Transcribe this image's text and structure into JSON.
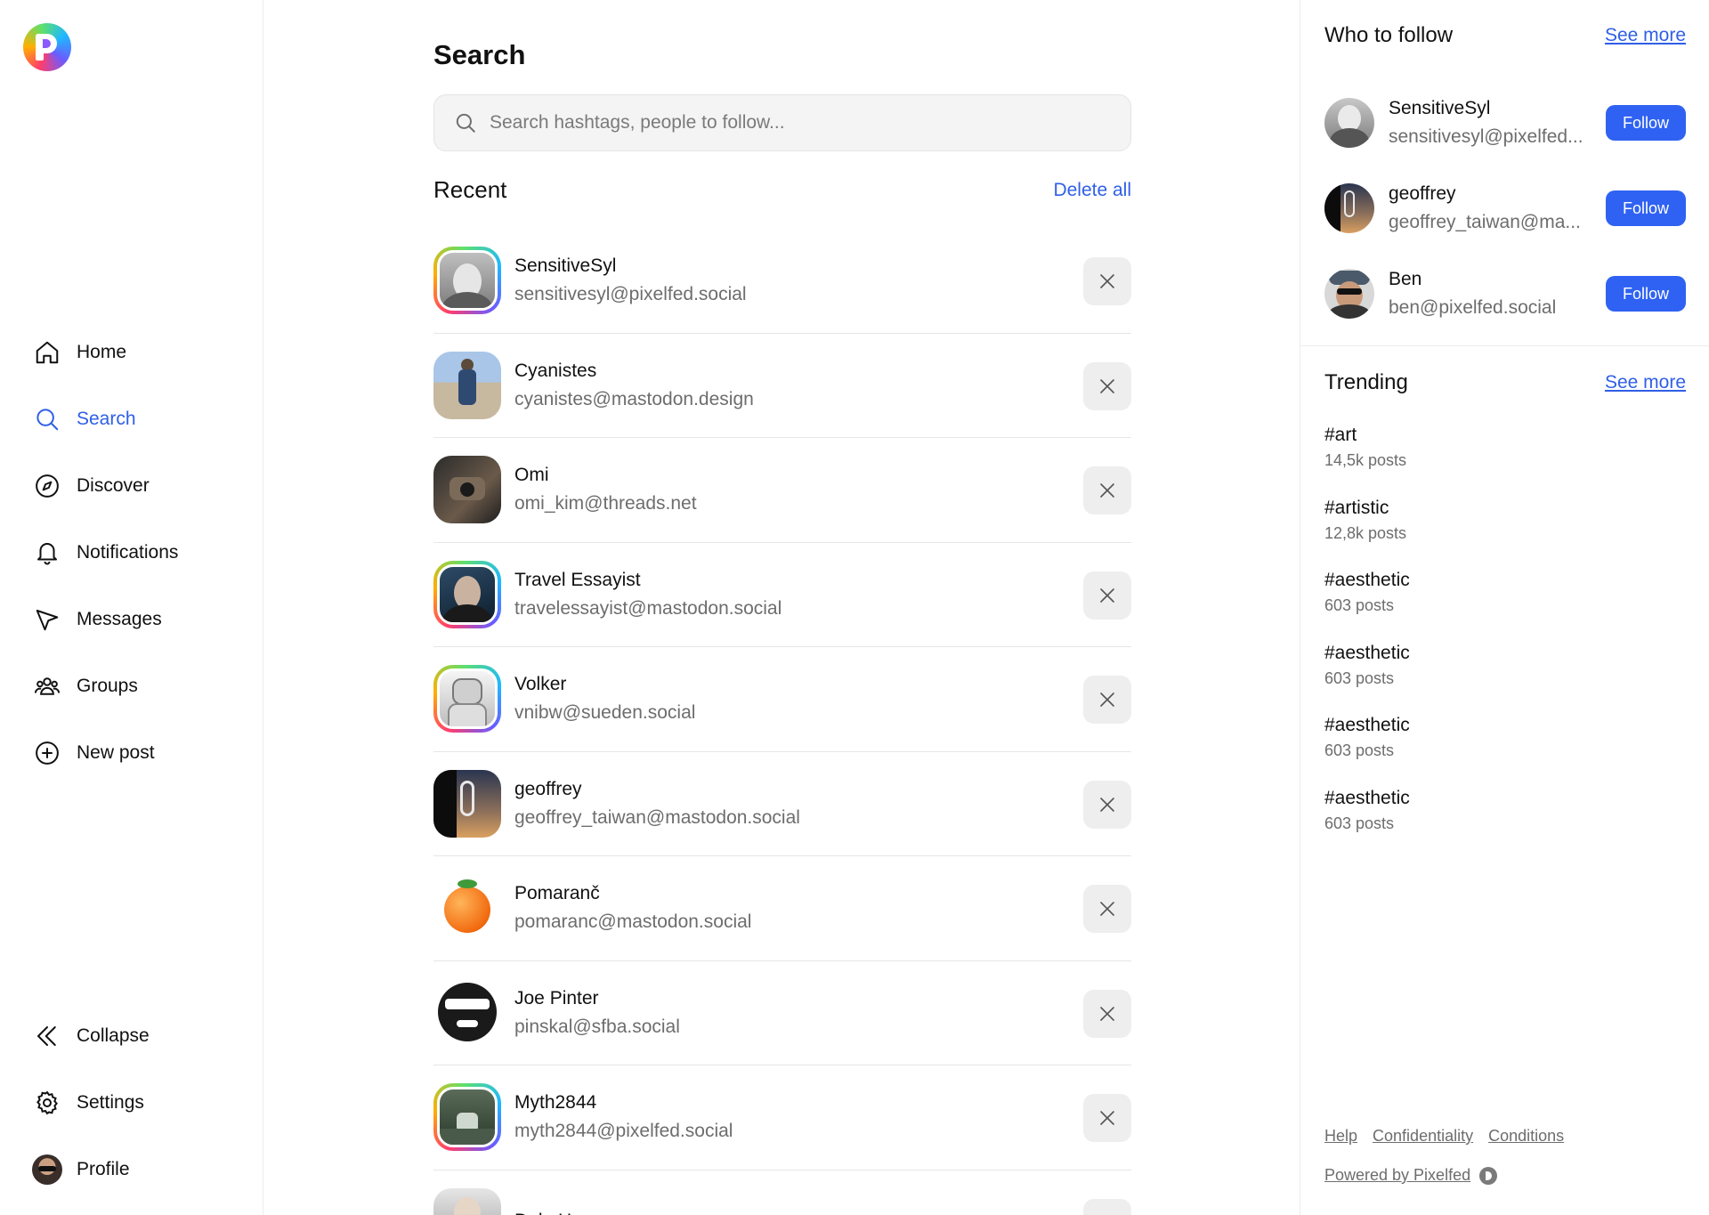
{
  "sidebar": {
    "nav": [
      {
        "label": "Home",
        "icon": "home-icon"
      },
      {
        "label": "Search",
        "icon": "search-icon",
        "active": true
      },
      {
        "label": "Discover",
        "icon": "compass-icon"
      },
      {
        "label": "Notifications",
        "icon": "bell-icon"
      },
      {
        "label": "Messages",
        "icon": "send-icon"
      },
      {
        "label": "Groups",
        "icon": "groups-icon"
      },
      {
        "label": "New post",
        "icon": "plus-circle-icon"
      }
    ],
    "bottom": [
      {
        "label": "Collapse",
        "icon": "chevrons-left-icon"
      },
      {
        "label": "Settings",
        "icon": "gear-icon"
      },
      {
        "label": "Profile",
        "icon": "avatar"
      }
    ]
  },
  "main": {
    "title": "Search",
    "search_placeholder": "Search hashtags, people to follow...",
    "recent_title": "Recent",
    "delete_all": "Delete all",
    "recent": [
      {
        "name": "SensitiveSyl",
        "handle": "sensitivesyl@pixelfed.social"
      },
      {
        "name": "Cyanistes",
        "handle": "cyanistes@mastodon.design"
      },
      {
        "name": "Omi",
        "handle": "omi_kim@threads.net"
      },
      {
        "name": "Travel Essayist",
        "handle": "travelessayist@mastodon.social"
      },
      {
        "name": "Volker",
        "handle": "vnibw@sueden.social"
      },
      {
        "name": "geoffrey",
        "handle": "geoffrey_taiwan@mastodon.social"
      },
      {
        "name": "Pomaranč",
        "handle": "pomaranc@mastodon.social"
      },
      {
        "name": "Joe Pinter",
        "handle": "pinskal@sfba.social"
      },
      {
        "name": "Myth2844",
        "handle": "myth2844@pixelfed.social"
      },
      {
        "name": "Dale Harvey",
        "handle": ""
      }
    ]
  },
  "who_to_follow": {
    "title": "Who to follow",
    "see_more": "See more",
    "follow_label": "Follow",
    "people": [
      {
        "name": "SensitiveSyl",
        "handle": "sensitivesyl@pixelfed..."
      },
      {
        "name": "geoffrey",
        "handle": "geoffrey_taiwan@ma..."
      },
      {
        "name": "Ben",
        "handle": "ben@pixelfed.social"
      }
    ]
  },
  "trending": {
    "title": "Trending",
    "see_more": "See more",
    "items": [
      {
        "tag": "#art",
        "count": "14,5k posts"
      },
      {
        "tag": "#artistic",
        "count": "12,8k posts"
      },
      {
        "tag": "#aesthetic",
        "count": "603 posts"
      },
      {
        "tag": "#aesthetic",
        "count": "603 posts"
      },
      {
        "tag": "#aesthetic",
        "count": "603 posts"
      },
      {
        "tag": "#aesthetic",
        "count": "603 posts"
      }
    ]
  },
  "footer": {
    "links": [
      "Help",
      "Confidentiality",
      "Conditions"
    ],
    "powered": "Powered by Pixelfed"
  },
  "colors": {
    "accent": "#2f5fe6",
    "follow_button": "#2f62f3",
    "muted_text": "#6d6d6d"
  }
}
